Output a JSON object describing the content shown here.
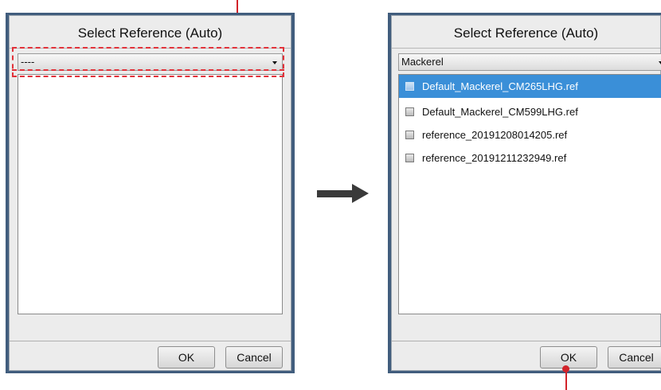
{
  "left_dialog": {
    "title": "Select Reference (Auto)",
    "combo_value": "----",
    "ok_label": "OK",
    "cancel_label": "Cancel",
    "items": []
  },
  "right_dialog": {
    "title": "Select Reference (Auto)",
    "combo_value": "Mackerel",
    "ok_label": "OK",
    "cancel_label": "Cancel",
    "items": [
      {
        "label": "Default_Mackerel_CM265LHG.ref",
        "selected": true
      },
      {
        "label": "Default_Mackerel_CM599LHG.ref",
        "selected": false
      },
      {
        "label": "reference_20191208014205.ref",
        "selected": false
      },
      {
        "label": "reference_20191211232949.ref",
        "selected": false
      }
    ]
  },
  "annotation": {
    "highlight_color": "#e2323a",
    "arrow_icon": "right-arrow-icon"
  }
}
